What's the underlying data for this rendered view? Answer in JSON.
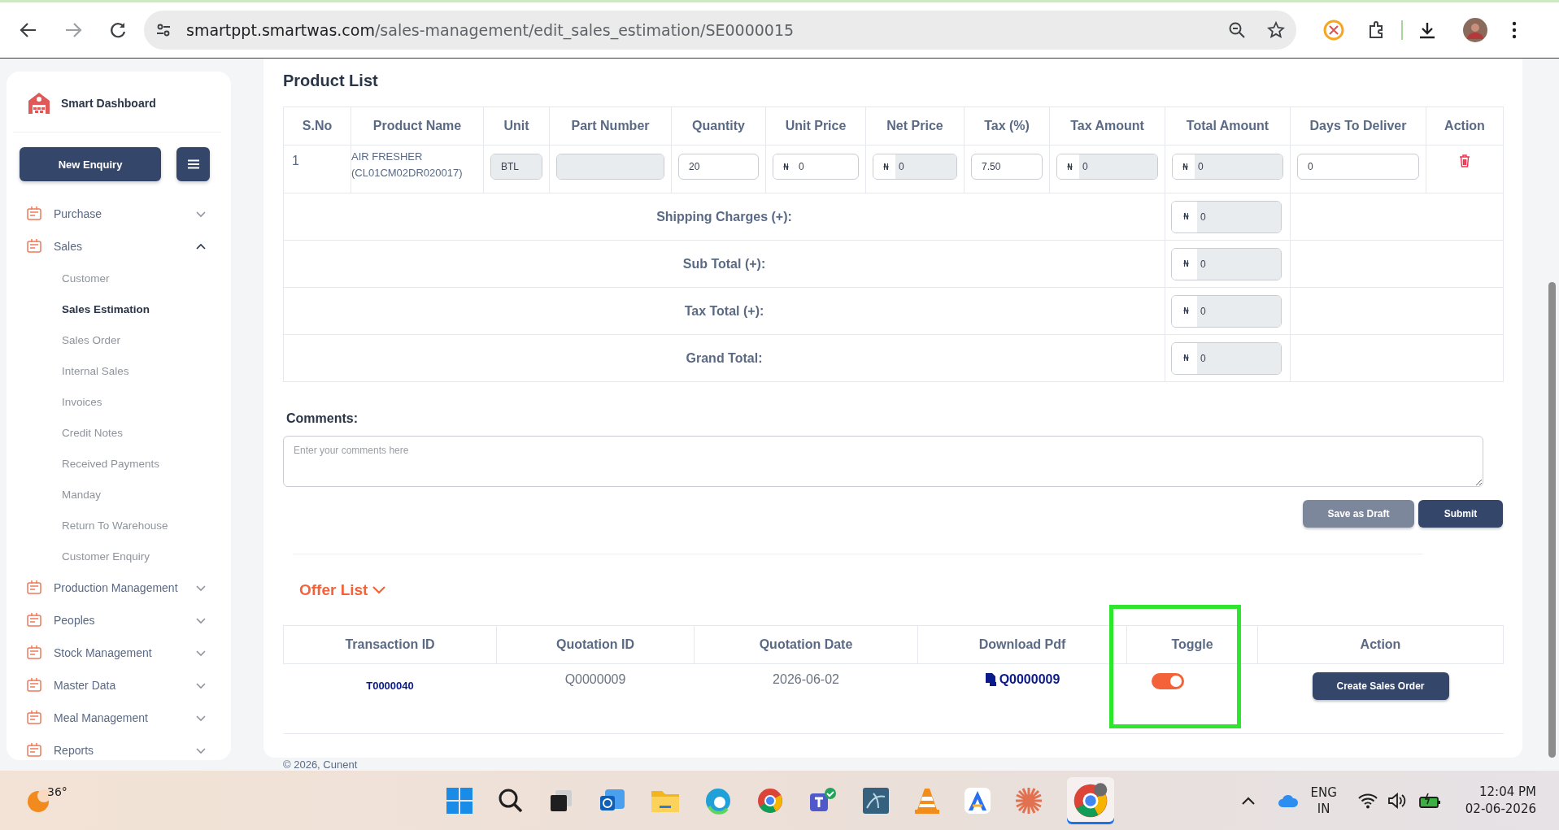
{
  "browser": {
    "url_host": "smartppt.smartwas.com",
    "url_path": "/sales-management/edit_sales_estimation/SE0000015"
  },
  "sidebar": {
    "brand": "Smart Dashboard",
    "new_enquiry": "New Enquiry",
    "items": [
      {
        "label": "Purchase",
        "expanded": false
      },
      {
        "label": "Sales",
        "expanded": true,
        "children": [
          {
            "label": "Customer",
            "selected": false
          },
          {
            "label": "Sales Estimation",
            "selected": true
          },
          {
            "label": "Sales Order",
            "selected": false
          },
          {
            "label": "Internal Sales",
            "selected": false
          },
          {
            "label": "Invoices",
            "selected": false
          },
          {
            "label": "Credit Notes",
            "selected": false
          },
          {
            "label": "Received Payments",
            "selected": false
          },
          {
            "label": "Manday",
            "selected": false
          },
          {
            "label": "Return To Warehouse",
            "selected": false
          },
          {
            "label": "Customer Enquiry",
            "selected": false
          }
        ]
      },
      {
        "label": "Production Management",
        "expanded": false
      },
      {
        "label": "Peoples",
        "expanded": false
      },
      {
        "label": "Stock Management",
        "expanded": false
      },
      {
        "label": "Master Data",
        "expanded": false
      },
      {
        "label": "Meal Management",
        "expanded": false
      },
      {
        "label": "Reports",
        "expanded": false
      }
    ]
  },
  "product_list": {
    "title": "Product List",
    "columns": [
      "S.No",
      "Product Name",
      "Unit",
      "Part Number",
      "Quantity",
      "Unit Price",
      "Net Price",
      "Tax (%)",
      "Tax Amount",
      "Total Amount",
      "Days To Deliver",
      "Action"
    ],
    "rows": [
      {
        "cells": [
          {
            "kind": "text",
            "value": "1"
          },
          {
            "kind": "text",
            "value": "AIR FRESHER (CL01CM02DR020017)"
          },
          {
            "kind": "field",
            "value": "BTL",
            "disabled": true
          },
          {
            "kind": "field",
            "disabled": true
          },
          {
            "kind": "field",
            "value": "20",
            "disabled": false
          },
          {
            "kind": "currency",
            "symbol": "₦",
            "value": "0",
            "disabled": false
          },
          {
            "kind": "currency",
            "symbol": "₦",
            "value": "0",
            "disabled": true
          },
          {
            "kind": "field",
            "value": "7.50",
            "disabled": false
          },
          {
            "kind": "currency",
            "symbol": "₦",
            "value": "0",
            "disabled": true
          },
          {
            "kind": "currency",
            "symbol": "₦",
            "value": "0",
            "disabled": true
          },
          {
            "kind": "field",
            "value": "0",
            "disabled": false
          },
          {
            "kind": "delete"
          }
        ]
      }
    ],
    "totals": [
      {
        "label": "Shipping Charges (+):",
        "symbol": "₦",
        "value": "0"
      },
      {
        "label": "Sub Total (+):",
        "symbol": "₦",
        "value": "0"
      },
      {
        "label": "Tax Total (+):",
        "symbol": "₦",
        "value": "0"
      },
      {
        "label": "Grand Total:",
        "symbol": "₦",
        "value": "0"
      }
    ],
    "comments_label": "Comments:",
    "comments_placeholder": "Enter your comments here",
    "buttons": [
      "Save as Draft",
      "Submit"
    ]
  },
  "offer_list": {
    "title": "Offer List",
    "columns": [
      "Transaction ID",
      "Quotation ID",
      "Quotation Date",
      "Download Pdf",
      "Toggle",
      "Action"
    ],
    "rows": [
      {
        "transaction_id": "T0000040",
        "quotation_id": "Q0000009",
        "date": "2026-06-02",
        "pdf": "Q0000009",
        "toggle_on": true,
        "action": "Create Sales Order"
      }
    ]
  },
  "footer": "© 2026, Cunent",
  "taskbar": {
    "weather": "36°",
    "language": "ENG",
    "region": "IN",
    "time": "12:04 PM",
    "date": "02-06-2026"
  }
}
